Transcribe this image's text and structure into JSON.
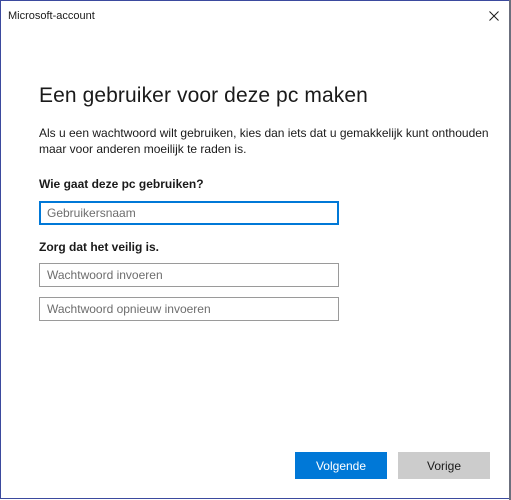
{
  "window": {
    "title": "Microsoft-account",
    "close_icon": "close-icon"
  },
  "main": {
    "heading": "Een gebruiker voor deze pc maken",
    "description": "Als u een wachtwoord wilt gebruiken, kies dan iets dat u gemakkelijk kunt onthouden maar voor anderen moeilijk te raden is.",
    "who_label": "Wie gaat deze pc gebruiken?",
    "username_placeholder": "Gebruikersnaam",
    "username_value": "",
    "security_label": "Zorg dat het veilig is.",
    "password_placeholder": "Wachtwoord invoeren",
    "password_value": "",
    "password_confirm_placeholder": "Wachtwoord opnieuw invoeren",
    "password_confirm_value": ""
  },
  "buttons": {
    "next_label": "Volgende",
    "back_label": "Vorige"
  },
  "colors": {
    "accent": "#0078d7",
    "secondary_button": "#cccccc",
    "window_border": "#3b4a9e"
  }
}
